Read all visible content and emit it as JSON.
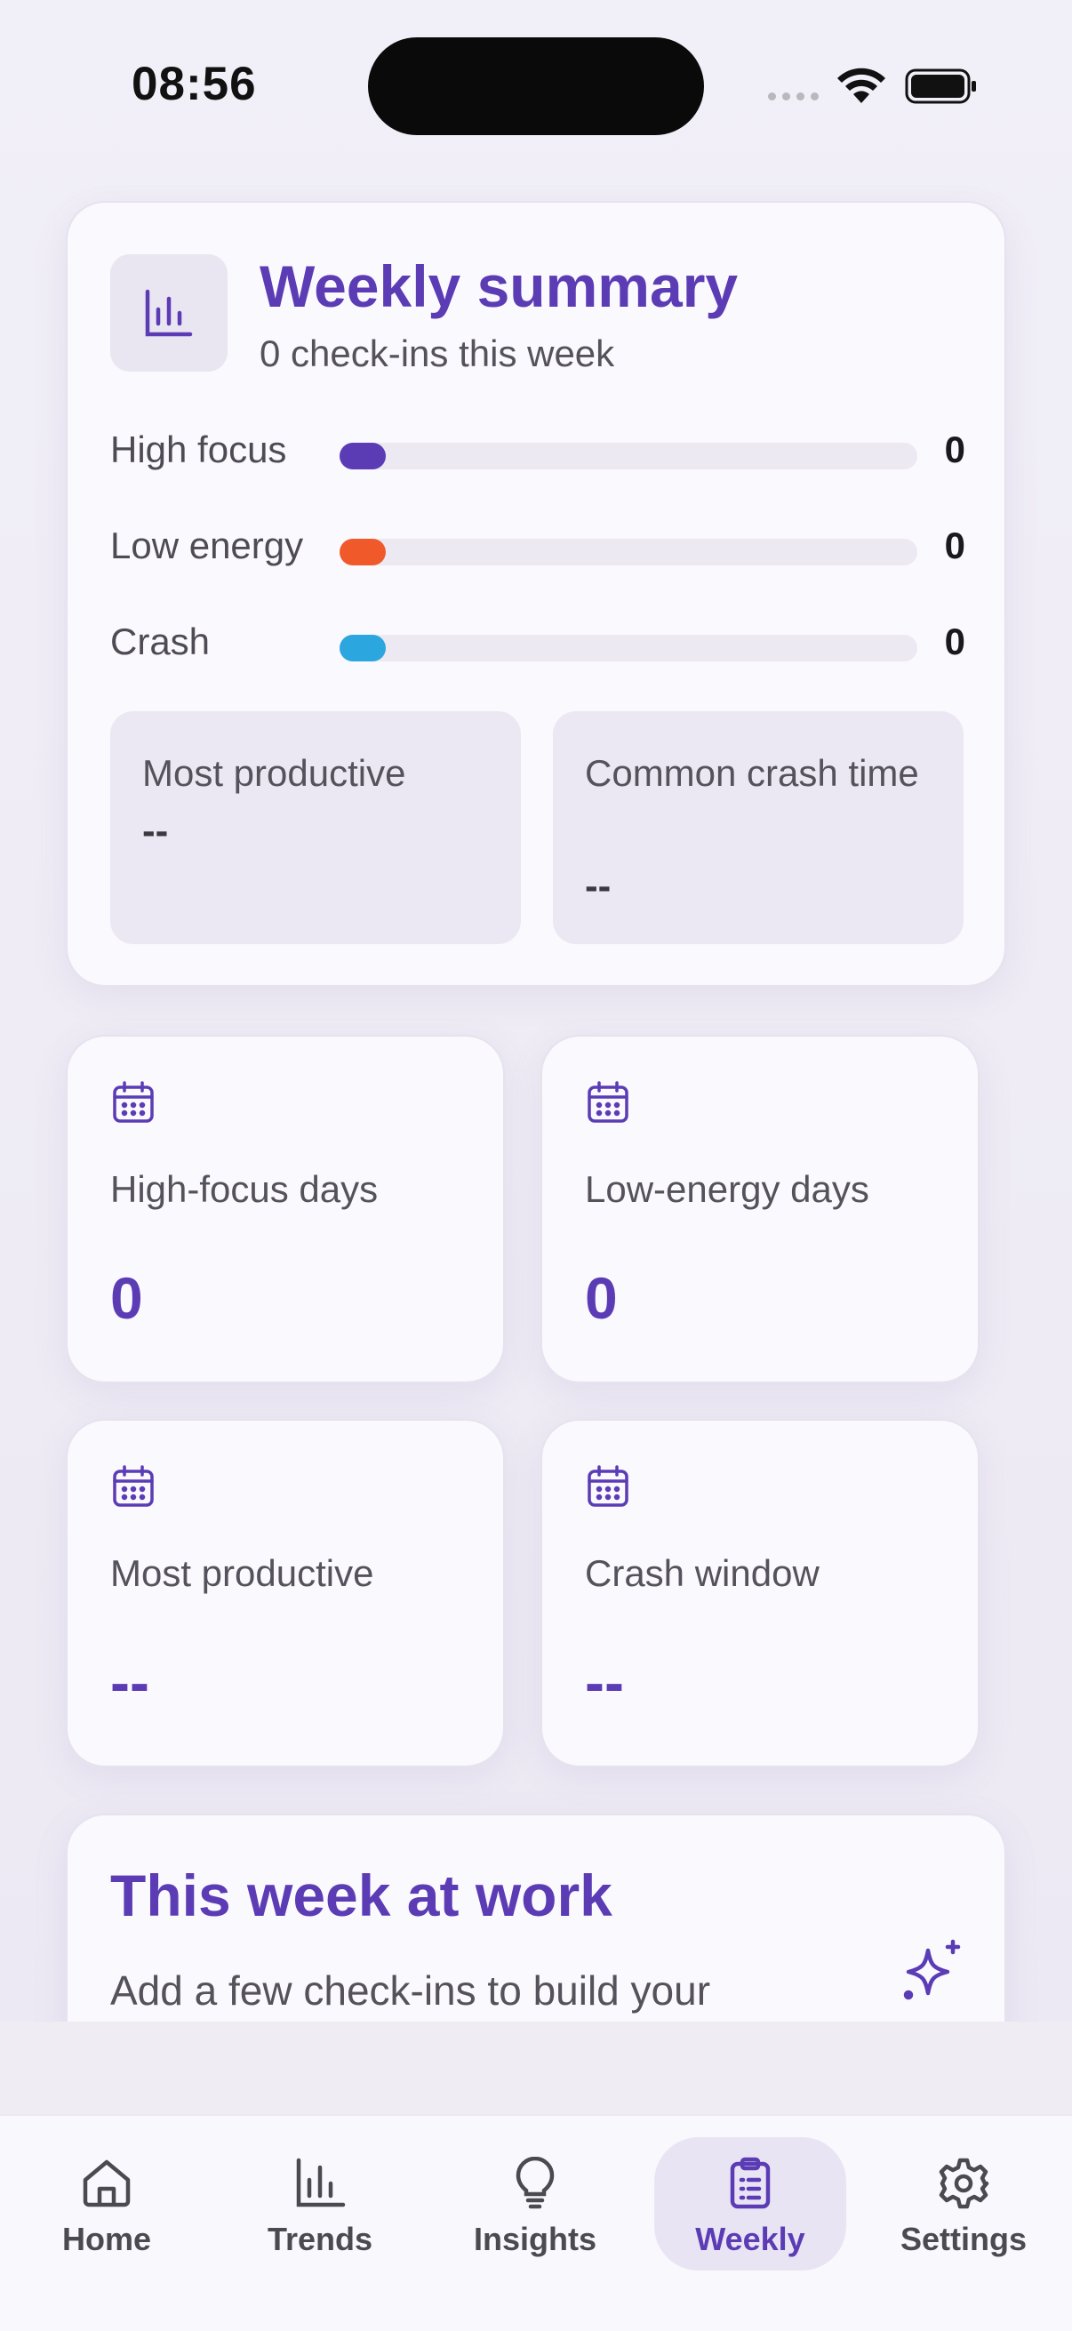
{
  "status_bar": {
    "time": "08:56"
  },
  "summary": {
    "title": "Weekly summary",
    "subtitle": "0 check-ins this week",
    "bars": [
      {
        "label": "High focus",
        "value": "0",
        "color": "#5b3cb5"
      },
      {
        "label": "Low energy",
        "value": "0",
        "color": "#f05a2b"
      },
      {
        "label": "Crash",
        "value": "0",
        "color": "#2ba6df"
      }
    ],
    "most_productive": {
      "label": "Most productive",
      "value": "--"
    },
    "common_crash": {
      "label": "Common crash time",
      "value": "--"
    }
  },
  "stats": [
    {
      "label": "High-focus days",
      "value": "0"
    },
    {
      "label": "Low-energy days",
      "value": "0"
    },
    {
      "label": "Most productive",
      "value": "--"
    },
    {
      "label": "Crash window",
      "value": "--"
    }
  ],
  "work": {
    "title": "This week at work",
    "text": "Add a few check-ins to build your"
  },
  "nav": [
    {
      "label": "Home",
      "icon": "home-icon"
    },
    {
      "label": "Trends",
      "icon": "bar-chart-icon"
    },
    {
      "label": "Insights",
      "icon": "lightbulb-icon"
    },
    {
      "label": "Weekly",
      "icon": "clipboard-icon",
      "active": true
    },
    {
      "label": "Settings",
      "icon": "gear-icon"
    }
  ],
  "colors": {
    "accent": "#5b3cb5",
    "background": "#eeebf4"
  }
}
